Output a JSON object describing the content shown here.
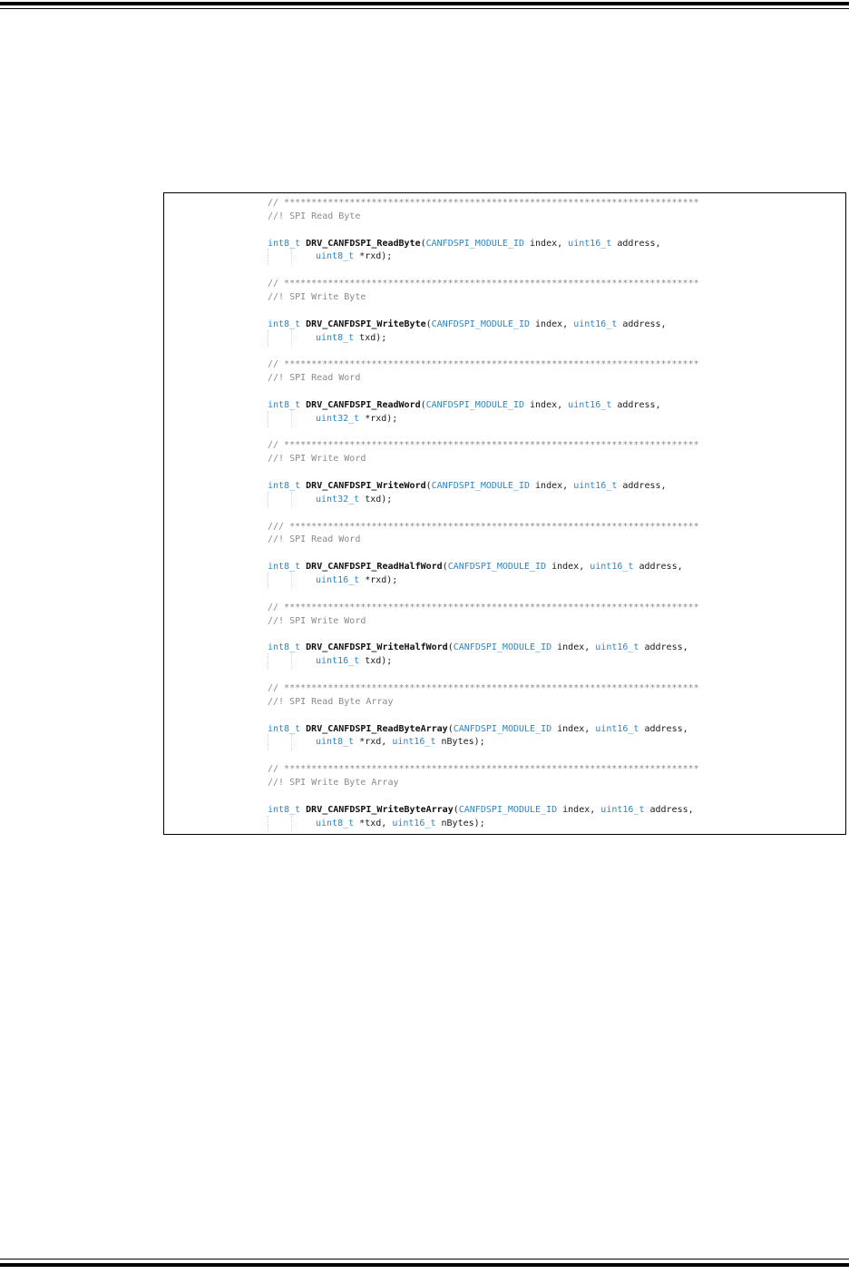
{
  "blocks": [
    {
      "separator": "// ****************************************************************************",
      "comment": "//! SPI Read Byte",
      "ret_type": "int8_t",
      "func": "DRV_CANFDSPI_ReadByte",
      "p1_type": "CANFDSPI_MODULE_ID",
      "p1_name": " index, ",
      "p2_type": "uint16_t",
      "p2_name": " address,",
      "p3_type": "uint8_t",
      "p3_name": " *rxd",
      "p4_type": "",
      "p4_name": "",
      "end": ");"
    },
    {
      "separator": "// ****************************************************************************",
      "comment": "//! SPI Write Byte",
      "ret_type": "int8_t",
      "func": "DRV_CANFDSPI_WriteByte",
      "p1_type": "CANFDSPI_MODULE_ID",
      "p1_name": " index, ",
      "p2_type": "uint16_t",
      "p2_name": " address,",
      "p3_type": "uint8_t",
      "p3_name": " txd",
      "p4_type": "",
      "p4_name": "",
      "end": ");"
    },
    {
      "separator": "// ****************************************************************************",
      "comment": "//! SPI Read Word",
      "ret_type": "int8_t",
      "func": "DRV_CANFDSPI_ReadWord",
      "p1_type": "CANFDSPI_MODULE_ID",
      "p1_name": " index, ",
      "p2_type": "uint16_t",
      "p2_name": " address,",
      "p3_type": "uint32_t",
      "p3_name": " *rxd",
      "p4_type": "",
      "p4_name": "",
      "end": ");"
    },
    {
      "separator": "// ****************************************************************************",
      "comment": "//! SPI Write Word",
      "ret_type": "int8_t",
      "func": "DRV_CANFDSPI_WriteWord",
      "p1_type": "CANFDSPI_MODULE_ID",
      "p1_name": " index, ",
      "p2_type": "uint16_t",
      "p2_name": " address,",
      "p3_type": "uint32_t",
      "p3_name": " txd",
      "p4_type": "",
      "p4_name": "",
      "end": ");"
    },
    {
      "separator": "/// ***************************************************************************",
      "comment": "//! SPI Read Word",
      "ret_type": "int8_t",
      "func": "DRV_CANFDSPI_ReadHalfWord",
      "p1_type": "CANFDSPI_MODULE_ID",
      "p1_name": " index, ",
      "p2_type": "uint16_t",
      "p2_name": " address,",
      "p3_type": "uint16_t",
      "p3_name": " *rxd",
      "p4_type": "",
      "p4_name": "",
      "end": ");"
    },
    {
      "separator": "// ****************************************************************************",
      "comment": "//! SPI Write Word",
      "ret_type": "int8_t",
      "func": "DRV_CANFDSPI_WriteHalfWord",
      "p1_type": "CANFDSPI_MODULE_ID",
      "p1_name": " index, ",
      "p2_type": "uint16_t",
      "p2_name": " address,",
      "p3_type": "uint16_t",
      "p3_name": " txd",
      "p4_type": "",
      "p4_name": "",
      "end": ");"
    },
    {
      "separator": "// ****************************************************************************",
      "comment": "//! SPI Read Byte Array",
      "ret_type": "int8_t",
      "func": "DRV_CANFDSPI_ReadByteArray",
      "p1_type": "CANFDSPI_MODULE_ID",
      "p1_name": " index, ",
      "p2_type": "uint16_t",
      "p2_name": " address,",
      "p3_type": "uint8_t",
      "p3_name": " *rxd, ",
      "p4_type": "uint16_t",
      "p4_name": " nBytes",
      "end": ");"
    },
    {
      "separator": "// ****************************************************************************",
      "comment": "//! SPI Write Byte Array",
      "ret_type": "int8_t",
      "func": "DRV_CANFDSPI_WriteByteArray",
      "p1_type": "CANFDSPI_MODULE_ID",
      "p1_name": " index, ",
      "p2_type": "uint16_t",
      "p2_name": " address,",
      "p3_type": "uint8_t",
      "p3_name": " *txd, ",
      "p4_type": "uint16_t",
      "p4_name": " nBytes",
      "end": ");"
    }
  ],
  "colors": {
    "comment": "#8a8a8a",
    "type": "#2f86c0",
    "text": "#1a1a1a"
  }
}
